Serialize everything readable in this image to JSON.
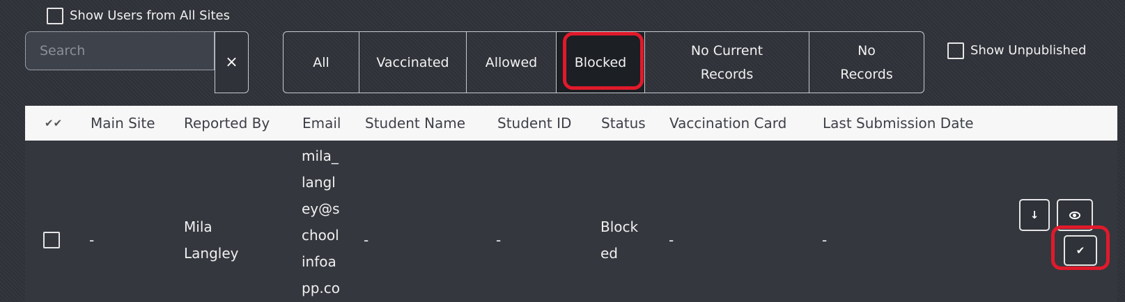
{
  "show_all_sites": {
    "label": "Show Users from All Sites",
    "checked": false
  },
  "search": {
    "placeholder": "Search",
    "value": "",
    "clear_label": "×"
  },
  "filters": [
    {
      "label": "All",
      "active": false
    },
    {
      "label": "Vaccinated",
      "active": false
    },
    {
      "label": "Allowed",
      "active": false
    },
    {
      "label": "Blocked",
      "active": true
    },
    {
      "label": "No Current\nRecords",
      "active": false
    },
    {
      "label": "No\nRecords",
      "active": false
    }
  ],
  "show_unpublished": {
    "label": "Show Unpublished",
    "checked": false
  },
  "table": {
    "select_all_icon": "double-check-icon",
    "columns": [
      "Main Site",
      "Reported By",
      "Email",
      "Student Name",
      "Student ID",
      "Status",
      "Vaccination Card",
      "Last Submission Date"
    ],
    "rows": [
      {
        "main_site": "-",
        "reported_by": "Mila\nLangley",
        "email": "mila_\nlangl\ney@s\nchool\ninfoa\npp.co",
        "student_name": "-",
        "student_id": "-",
        "status": "Block\ned",
        "vaccination_card": "-",
        "last_submission_date": "-",
        "actions": [
          {
            "icon": "download-icon",
            "glyph": "↓"
          },
          {
            "icon": "eye-icon",
            "glyph": "👁"
          },
          {
            "icon": "check-icon",
            "glyph": "✔"
          }
        ]
      }
    ]
  },
  "colors": {
    "highlight": "#e01a2b",
    "background": "#2f3239",
    "header_bg": "#f7f7f7"
  }
}
